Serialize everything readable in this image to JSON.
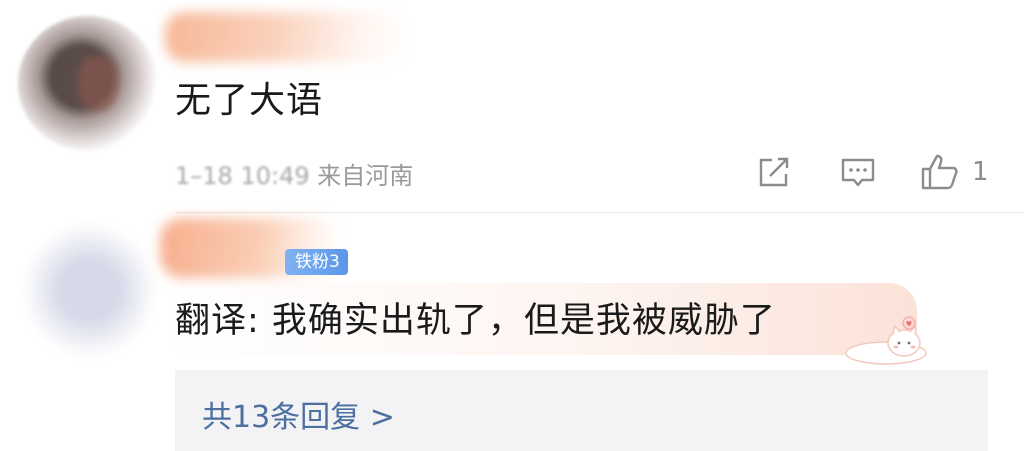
{
  "comment1": {
    "text": "无了大语",
    "time": "1–18 10:49",
    "location": "来自河南",
    "actions": {
      "share_icon": "share-icon",
      "reply_icon": "comment-icon",
      "like_icon": "thumbs-up-icon",
      "like_count": "1"
    }
  },
  "comment2": {
    "badge": "铁粉3",
    "text": "翻译: 我确实出轨了，但是我被威胁了",
    "replies_label": "共13条回复 >"
  },
  "colors": {
    "badge_blue": "#5c96e8",
    "link_blue": "#4a6fa0",
    "meta_gray": "#9a9a9a",
    "bubble_pink": "#fbe2d8"
  }
}
